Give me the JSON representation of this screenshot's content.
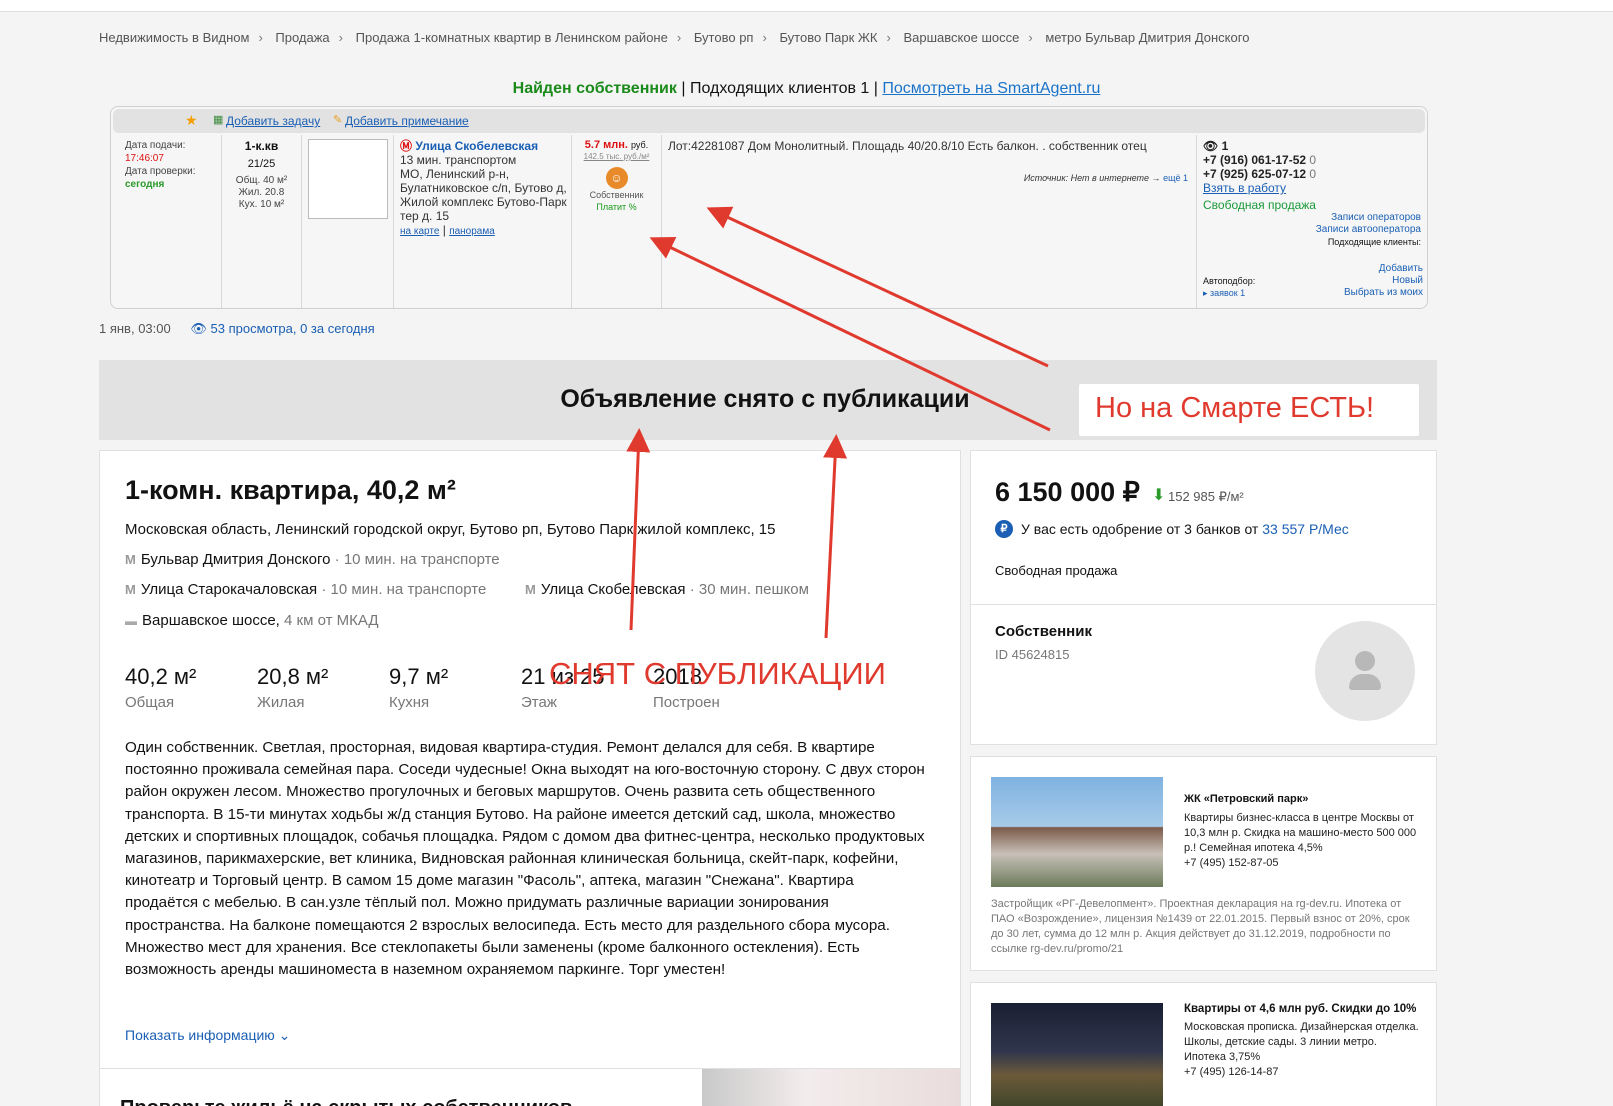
{
  "breadcrumbs": [
    "Недвижимость в Видном",
    "Продажа",
    "Продажа 1-комнатных квартир в Ленинском районе",
    "Бутово рп",
    "Бутово Парк ЖК",
    "Варшавское шоссе",
    "метро Бульвар Дмитрия Донского"
  ],
  "smartagent": {
    "found": "Найден собственник",
    "clients": "Подходящих клиентов 1",
    "link": "Посмотреть на SmartAgent.ru",
    "add_task": "Добавить задачу",
    "add_note": "Добавить примечание",
    "date_label": "Дата подачи:",
    "date_value": "17:46:07",
    "check_label": "Дата проверки:",
    "check_value": "сегодня",
    "rooms": "1-к.кв",
    "floor": "21/25",
    "area_total": "Общ. 40 м²",
    "area_living": "Жил. 20.8",
    "area_kitchen": "Кух. 10 м²",
    "metro": "Улица Скобелевская",
    "transport": "13 мин. транспортом",
    "address": "МО, Ленинский р-н, Булатниковское с/п, Бутово д, Жилой комплекс Бутово-Парк тер д. 15",
    "map_link": "на карте",
    "pano_link": "панорама",
    "price": "5.7 млн.",
    "price_unit": "руб.",
    "ppm": "142.5 тыс. руб./м²",
    "owner_label": "Собственник",
    "pays": "Платит %",
    "lot": "Лот:42281087 Дом Монолитный. Площадь 40/20.8/10 Есть балкон. . собственник отец",
    "source": "Источник: Нет в интернете →",
    "source_more": "ещё 1",
    "views": "1",
    "phone1": "+7 (916) 061-17-52",
    "phone1_count": "0",
    "phone2": "+7 (925) 625-07-12",
    "phone2_count": "0",
    "take": "Взять в работу",
    "free_sale": "Свободная продажа",
    "op_records": "Записи операторов",
    "auto_records": "Записи автооператора",
    "matching": "Подходящие клиенты:",
    "autopick": "Автоподбор:",
    "requests": "заявок 1",
    "add": "Добавить",
    "new": "Новый",
    "choose": "Выбрать из моих"
  },
  "meta": {
    "date": "1 янв, 03:00",
    "views": "53 просмотра, 0 за сегодня"
  },
  "removed_banner": "Объявление снято с публикации",
  "listing": {
    "title": "1-комн. квартира, 40,2 м²",
    "address": "Московская область, Ленинский городской округ, Бутово рп, Бутово Парк жилой комплекс, 15",
    "metro1": "Бульвар Дмитрия Донского",
    "metro1_time": "· 10 мин. на транспорте",
    "metro2": "Улица Старокачаловская",
    "metro2_time": "· 10 мин. на транспорте",
    "metro3": "Улица Скобелевская",
    "metro3_time": "· 30 мин. пешком",
    "road": "Варшавское шоссе,",
    "road_dist": "4 км от МКАД",
    "stats": [
      {
        "value": "40,2 м²",
        "label": "Общая"
      },
      {
        "value": "20,8 м²",
        "label": "Жилая"
      },
      {
        "value": "9,7 м²",
        "label": "Кухня"
      },
      {
        "value": "21 из 25",
        "label": "Этаж"
      },
      {
        "value": "2018",
        "label": "Построен"
      }
    ],
    "description": "Один собственник. Светлая, просторная, видовая квартира-студия. Ремонт делался для себя. В квартире постоянно проживала семейная пара. Соседи чудесные! Окна выходят на юго-восточную сторону. С двух сторон район окружен лесом. Множество прогулочных и беговых маршрутов. Очень развита сеть общественного транспорта. В 15-ти минутах ходьбы ж/д станция Бутово. На районе имеется детский сад, школа, множество детских и спортивных площадок, собачья площадка. Рядом с домом два фитнес-центра, несколько продуктовых магазинов, парикмахерские, вет клиника, Видновская районная клиническая больница, скейт-парк, кофейни, кинотеатр и Торговый центр. В самом 15 доме магазин \"Фасоль\", аптека, магазин \"Снежана\". Квартира продаётся с мебелью. В сан.узле тёплый пол. Можно придумать различные вариации зонирования пространства. На балконе помещаются 2 взрослых велосипеда. Есть место для раздельного сбора мусора. Множество мест для хранения. Все стеклопакеты были заменены (кроме балконного остекления). Есть возможность аренды машиноместа в наземном охраняемом паркинге. Торг уместен!",
    "show_more": "Показать информацию ⌄",
    "check_title": "Проверьте жильё на скрытых собственников"
  },
  "price": {
    "value": "6 150 000 ₽",
    "ppm": "152 985 ₽/м²",
    "mortgage_text": "У вас есть одобрение от 3 банков от",
    "mortgage_link": "33 557 Р/Мес",
    "sale_type": "Свободная продажа"
  },
  "owner": {
    "label": "Собственник",
    "id": "ID 45624815"
  },
  "ads": [
    {
      "title": "ЖК «Петровский парк»",
      "text": "Квартиры бизнес-класса в центре Москвы от 10,3 млн р. Скидка на машино-место 500 000 р.! Семейная ипотека 4,5%",
      "phone": "+7 (495) 152-87-05",
      "legal": "Застройщик «РГ-Девелопмент». Проектная декларация на rg-dev.ru. Ипотека от ПАО «Возрождение», лицензия №1439 от 22.01.2015. Первый взнос от 20%, срок до 30 лет, сумма до 12 млн р. Акция действует до 31.12.2019, подробности по ссылке rg-dev.ru/promo/21"
    },
    {
      "title": "Квартиры от 4,6 млн руб. Скидки до 10%",
      "text": "Московская прописка. Дизайнерская отделка. Школы, детские сады. 3 линии метро. Ипотека 3,75%",
      "phone": "+7 (495) 126-14-87"
    }
  ],
  "annotations": {
    "callout": "Но на Смарте ЕСТЬ!",
    "removed_note": "СНЯТ С ПУБЛИКАЦИИ",
    "color": "#e03a2f"
  }
}
